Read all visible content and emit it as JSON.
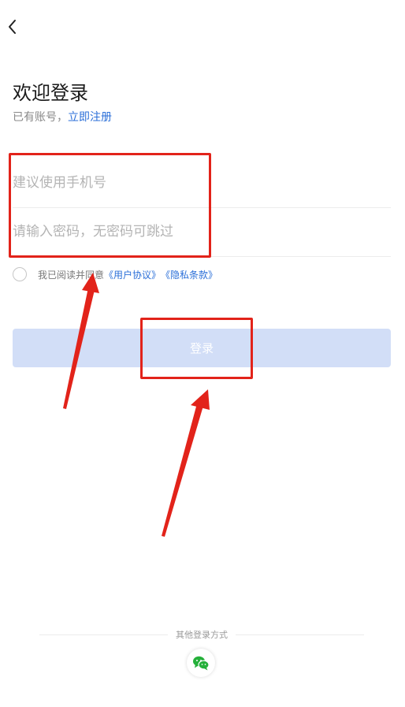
{
  "header": {
    "back_icon": "chevron-left-icon"
  },
  "login": {
    "title": "欢迎登录",
    "has_account_text": "已有账号，",
    "register_link": "立即注册",
    "phone_placeholder": "建议使用手机号",
    "password_placeholder": "请输入密码，无密码可跳过",
    "agree_prefix": "我已阅读并同意",
    "user_agreement": "《用户协议》",
    "privacy_policy": "《隐私条款》",
    "login_button": "登录"
  },
  "other_login": {
    "label": "其他登录方式",
    "wechat_icon": "wechat-icon"
  },
  "colors": {
    "link": "#2b6fd8",
    "button_disabled": "#d2def7",
    "annotation": "#e2231a",
    "wechat": "#25b03a"
  }
}
